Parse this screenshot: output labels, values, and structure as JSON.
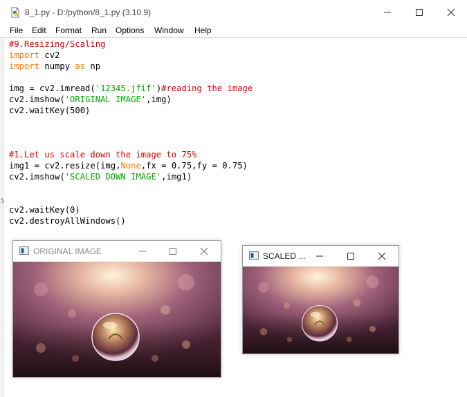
{
  "window": {
    "title": "8_1.py - D:/python/8_1.py (3.10.9)",
    "controls": {
      "minimize": "minimize-icon",
      "maximize": "maximize-icon",
      "close": "close-icon"
    }
  },
  "menu": [
    "File",
    "Edit",
    "Format",
    "Run",
    "Options",
    "Window",
    "Help"
  ],
  "gutter_mark": "5",
  "code": [
    [
      {
        "t": "#9.Resizing/Scaling",
        "c": "cm"
      }
    ],
    [
      {
        "t": "import",
        "c": "kw"
      },
      {
        "t": " cv2",
        "c": ""
      }
    ],
    [
      {
        "t": "import",
        "c": "kw"
      },
      {
        "t": " numpy ",
        "c": ""
      },
      {
        "t": "as",
        "c": "kw"
      },
      {
        "t": " np",
        "c": ""
      }
    ],
    [],
    [
      {
        "t": "img = cv2.imread(",
        "c": ""
      },
      {
        "t": "'12345.jfif'",
        "c": "st"
      },
      {
        "t": ")",
        "c": ""
      },
      {
        "t": "#reading the image",
        "c": "cm"
      }
    ],
    [
      {
        "t": "cv2.imshow(",
        "c": ""
      },
      {
        "t": "'ORIGINAL IMAGE'",
        "c": "st"
      },
      {
        "t": ",img)",
        "c": ""
      }
    ],
    [
      {
        "t": "cv2.waitKey(500)",
        "c": ""
      }
    ],
    [],
    [],
    [],
    [
      {
        "t": "#1.Let us scale down the image to 75%",
        "c": "cm"
      }
    ],
    [
      {
        "t": "img1 = cv2.resize(img,",
        "c": ""
      },
      {
        "t": "None",
        "c": "kw"
      },
      {
        "t": ",fx = 0.75,fy = 0.75)",
        "c": ""
      }
    ],
    [
      {
        "t": "cv2.imshow(",
        "c": ""
      },
      {
        "t": "'SCALED DOWN IMAGE'",
        "c": "st"
      },
      {
        "t": ",img1)",
        "c": ""
      }
    ],
    [],
    [],
    [
      {
        "t": "cv2.waitKey(0)",
        "c": ""
      }
    ],
    [
      {
        "t": "cv2.destroyAllWindows()",
        "c": ""
      }
    ]
  ],
  "cv_windows": [
    {
      "title": "ORIGINAL IMAGE",
      "image": "bokeh-glass-sphere-photo"
    },
    {
      "title": "SCALED ...",
      "image": "bokeh-glass-sphere-photo-scaled"
    }
  ],
  "colors": {
    "keyword": "#ff7700",
    "comment": "#dd0000",
    "string": "#00aa00"
  }
}
